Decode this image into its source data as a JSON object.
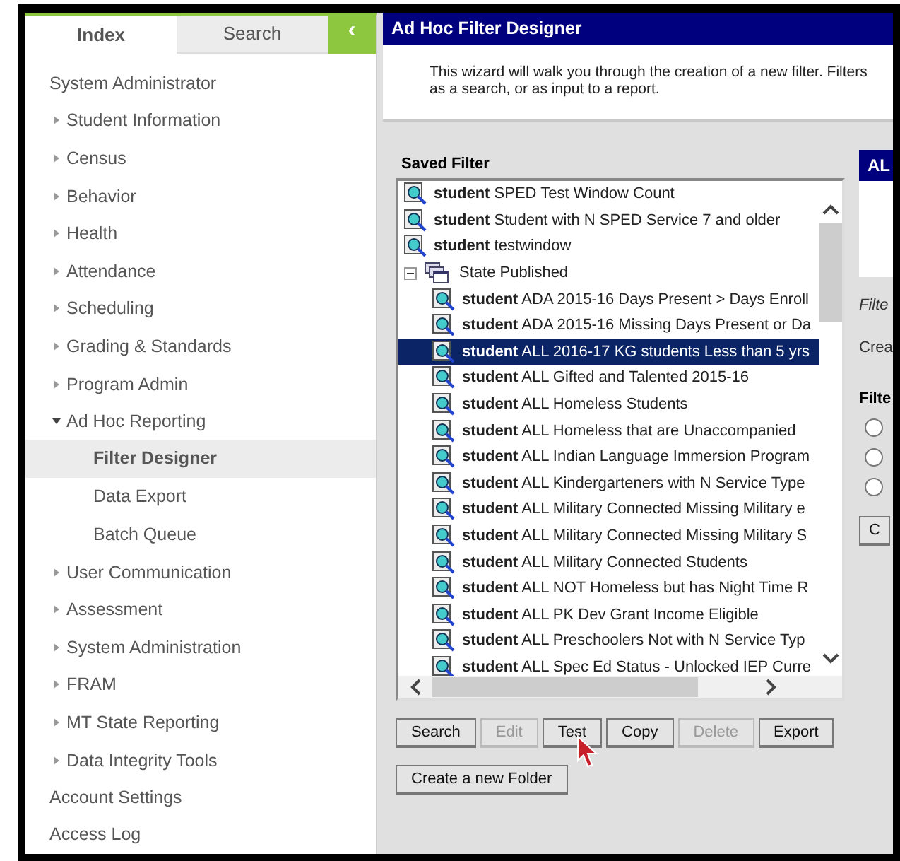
{
  "sidebar": {
    "tabs": [
      {
        "label": "Index",
        "selected": true
      },
      {
        "label": "Search",
        "selected": false
      }
    ],
    "collapse_button": "‹",
    "items": [
      {
        "kind": "link",
        "label": "System Administrator"
      },
      {
        "kind": "group",
        "label": "Student Information",
        "expanded": false
      },
      {
        "kind": "group",
        "label": "Census",
        "expanded": false
      },
      {
        "kind": "group",
        "label": "Behavior",
        "expanded": false
      },
      {
        "kind": "group",
        "label": "Health",
        "expanded": false
      },
      {
        "kind": "group",
        "label": "Attendance",
        "expanded": false
      },
      {
        "kind": "group",
        "label": "Scheduling",
        "expanded": false
      },
      {
        "kind": "group",
        "label": "Grading & Standards",
        "expanded": false
      },
      {
        "kind": "group",
        "label": "Program Admin",
        "expanded": false
      },
      {
        "kind": "group",
        "label": "Ad Hoc Reporting",
        "expanded": true,
        "children": [
          {
            "label": "Filter Designer",
            "selected": true
          },
          {
            "label": "Data Export",
            "selected": false
          },
          {
            "label": "Batch Queue",
            "selected": false
          }
        ]
      },
      {
        "kind": "group",
        "label": "User Communication",
        "expanded": false
      },
      {
        "kind": "group",
        "label": "Assessment",
        "expanded": false
      },
      {
        "kind": "group",
        "label": "System Administration",
        "expanded": false
      },
      {
        "kind": "group",
        "label": "FRAM",
        "expanded": false
      },
      {
        "kind": "group",
        "label": "MT State Reporting",
        "expanded": false
      },
      {
        "kind": "group",
        "label": "Data Integrity Tools",
        "expanded": false
      },
      {
        "kind": "link",
        "label": "Account Settings"
      },
      {
        "kind": "link",
        "label": "Access Log"
      }
    ]
  },
  "window": {
    "title": "Ad Hoc Filter Designer",
    "description_lines": [
      "This wizard will walk you through the creation of a new filter. Filters",
      "as a search, or as input to a report."
    ]
  },
  "saved_filter": {
    "label": "Saved Filter",
    "items": [
      {
        "kind": "filter",
        "owner": "student",
        "name": "SPED Test Window Count",
        "selected": false
      },
      {
        "kind": "filter",
        "owner": "student",
        "name": "Student with N SPED Service 7 and older",
        "selected": false
      },
      {
        "kind": "filter",
        "owner": "student",
        "name": "testwindow",
        "selected": false
      },
      {
        "kind": "folder",
        "name": "State Published",
        "expanded": true,
        "children": [
          {
            "kind": "filter",
            "owner": "student",
            "name": "ADA 2015-16 Days Present > Days Enroll",
            "selected": false
          },
          {
            "kind": "filter",
            "owner": "student",
            "name": "ADA 2015-16 Missing Days Present or Da",
            "selected": false
          },
          {
            "kind": "filter",
            "owner": "student",
            "name": "ALL 2016-17 KG students Less than 5 yrs",
            "selected": true
          },
          {
            "kind": "filter",
            "owner": "student",
            "name": "ALL Gifted and Talented 2015-16",
            "selected": false
          },
          {
            "kind": "filter",
            "owner": "student",
            "name": "ALL Homeless Students",
            "selected": false
          },
          {
            "kind": "filter",
            "owner": "student",
            "name": "ALL Homeless that are Unaccompanied",
            "selected": false
          },
          {
            "kind": "filter",
            "owner": "student",
            "name": "ALL Indian Language Immersion Program",
            "selected": false
          },
          {
            "kind": "filter",
            "owner": "student",
            "name": "ALL Kindergarteners with N Service Type",
            "selected": false
          },
          {
            "kind": "filter",
            "owner": "student",
            "name": "ALL Military Connected Missing Military e",
            "selected": false
          },
          {
            "kind": "filter",
            "owner": "student",
            "name": "ALL Military Connected Missing Military S",
            "selected": false
          },
          {
            "kind": "filter",
            "owner": "student",
            "name": "ALL Military Connected Students",
            "selected": false
          },
          {
            "kind": "filter",
            "owner": "student",
            "name": "ALL NOT Homeless but has Night Time R",
            "selected": false
          },
          {
            "kind": "filter",
            "owner": "student",
            "name": "ALL PK Dev Grant Income Eligible",
            "selected": false
          },
          {
            "kind": "filter",
            "owner": "student",
            "name": "ALL Preschoolers Not with N Service Typ",
            "selected": false
          },
          {
            "kind": "filter",
            "owner": "student",
            "name": "ALL Spec Ed Status - Unlocked IEP Curre",
            "selected": false
          }
        ]
      }
    ],
    "buttons": [
      {
        "label": "Search",
        "disabled": false
      },
      {
        "label": "Edit",
        "disabled": true
      },
      {
        "label": "Test",
        "disabled": false
      },
      {
        "label": "Copy",
        "disabled": false
      },
      {
        "label": "Delete",
        "disabled": true
      },
      {
        "label": "Export",
        "disabled": false
      }
    ],
    "folder_button": "Create a new Folder"
  },
  "side_panel": {
    "header": "AL",
    "field_label": "Filte",
    "section_label": "Crea",
    "group_label": "Filte",
    "radios": [
      {
        "selected": false
      },
      {
        "selected": false
      },
      {
        "selected": false
      }
    ],
    "button": "C"
  }
}
